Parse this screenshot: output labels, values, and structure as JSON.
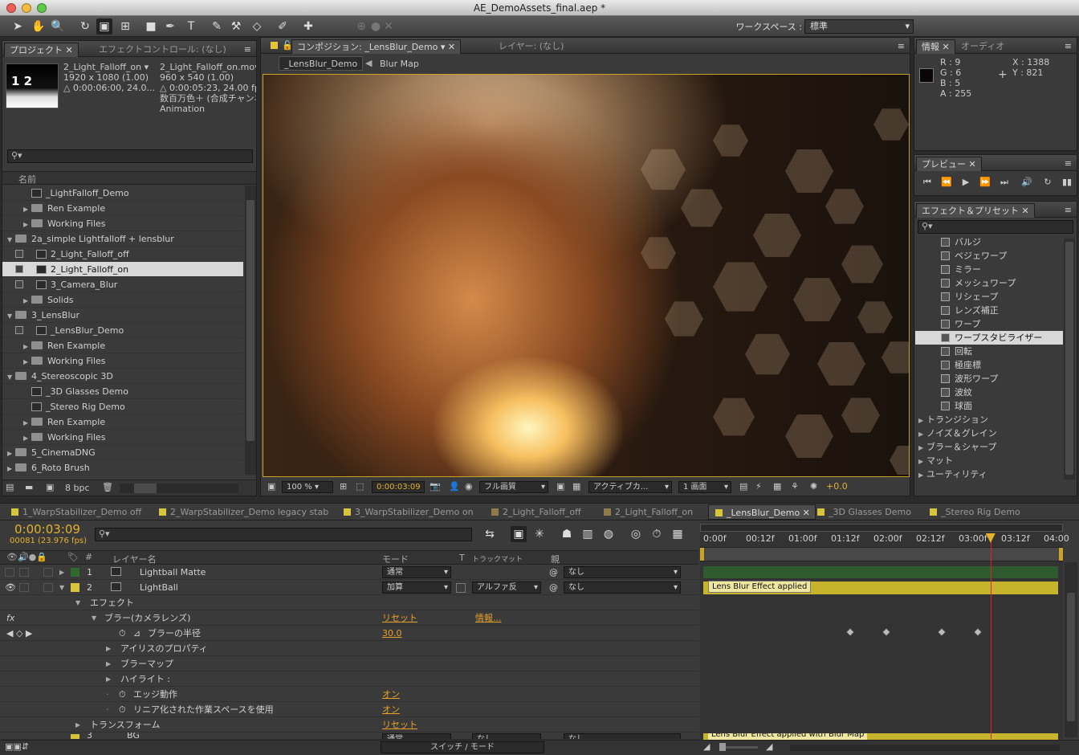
{
  "window": {
    "title": "AE_DemoAssets_final.aep *"
  },
  "workspace": {
    "label": "ワークスペース :",
    "value": "標準"
  },
  "project_panel": {
    "tabs": [
      "プロジェクト",
      "エフェクトコントロール: (なし)"
    ],
    "preview": {
      "thumb_text": "1 2",
      "name": "2_Light_Falloff_on ▾",
      "dims": "1920 x 1080 (1.00)",
      "duration": "△ 0:00:06:00, 24.0...",
      "src_name": "2_Light_Falloff_on.mov",
      "src_dims": "960 x 540 (1.00)",
      "src_duration": "△ 0:00:05:23, 24.00 fps",
      "src_color": "数百万色＋ (合成チャンネル)",
      "src_codec": "Animation"
    },
    "search_placeholder": "",
    "column_name": "名前",
    "items": [
      {
        "label": "_LightFalloff_Demo",
        "type": "comp",
        "indent": 2,
        "tri": ""
      },
      {
        "label": "Ren Example",
        "type": "folder",
        "indent": 2,
        "tri": "▶"
      },
      {
        "label": "Working Files",
        "type": "folder",
        "indent": 2,
        "tri": "▶"
      },
      {
        "label": "2a_simple Lightfalloff + lensblur",
        "type": "folder",
        "indent": 0,
        "tri": "▼"
      },
      {
        "label": "2_Light_Falloff_off",
        "type": "comp",
        "indent": 1,
        "tri": "",
        "chk": true
      },
      {
        "label": "2_Light_Falloff_on",
        "type": "comp",
        "indent": 1,
        "tri": "",
        "chk": true,
        "selected": true
      },
      {
        "label": "3_Camera_Blur",
        "type": "comp",
        "indent": 1,
        "tri": "",
        "chk": true
      },
      {
        "label": "Solids",
        "type": "folder",
        "indent": 2,
        "tri": "▶"
      },
      {
        "label": "3_LensBlur",
        "type": "folder",
        "indent": 0,
        "tri": "▼"
      },
      {
        "label": "_LensBlur_Demo",
        "type": "comp",
        "indent": 1,
        "tri": "",
        "chk": true
      },
      {
        "label": "Ren Example",
        "type": "folder",
        "indent": 2,
        "tri": "▶"
      },
      {
        "label": "Working Files",
        "type": "folder",
        "indent": 2,
        "tri": "▶"
      },
      {
        "label": "4_Stereoscopic 3D",
        "type": "folder",
        "indent": 0,
        "tri": "▼"
      },
      {
        "label": "_3D Glasses Demo",
        "type": "comp",
        "indent": 2,
        "tri": ""
      },
      {
        "label": "_Stereo Rig Demo",
        "type": "comp",
        "indent": 2,
        "tri": ""
      },
      {
        "label": "Ren Example",
        "type": "folder",
        "indent": 2,
        "tri": "▶"
      },
      {
        "label": "Working Files",
        "type": "folder",
        "indent": 2,
        "tri": "▶"
      },
      {
        "label": "5_CinemaDNG",
        "type": "folder",
        "indent": 0,
        "tri": "▶"
      },
      {
        "label": "6_Roto Brush",
        "type": "folder",
        "indent": 0,
        "tri": "▶"
      }
    ],
    "bpc": "8 bpc"
  },
  "comp_panel": {
    "tabs": [
      "コンポジション: _LensBlur_Demo",
      "レイヤー: (なし)"
    ],
    "breadcrumb": [
      "_LensBlur_Demo",
      "Blur Map"
    ],
    "zoom": "100 %",
    "timecode": "0:00:03:09",
    "resolution": "フル画質",
    "camera": "アクティブカ...",
    "views": "1 画面",
    "exposure": "+0.0"
  },
  "info_panel": {
    "tabs": [
      "情報",
      "オーディオ"
    ],
    "r": "R : 9",
    "g": "G : 6",
    "b": "B : 5",
    "a": "A : 255",
    "x": "X : 1388",
    "y": "Y : 821",
    "swatch": "#090605"
  },
  "preview_panel": {
    "tab": "プレビュー"
  },
  "effects_panel": {
    "tab": "エフェクト＆プリセット",
    "items": [
      {
        "label": "バルジ",
        "leaf": true
      },
      {
        "label": "ベジェワープ",
        "leaf": true
      },
      {
        "label": "ミラー",
        "leaf": true
      },
      {
        "label": "メッシュワープ",
        "leaf": true
      },
      {
        "label": "リシェープ",
        "leaf": true
      },
      {
        "label": "レンズ補正",
        "leaf": true
      },
      {
        "label": "ワープ",
        "leaf": true
      },
      {
        "label": "ワープスタビライザー",
        "leaf": true,
        "selected": true
      },
      {
        "label": "回転",
        "leaf": true
      },
      {
        "label": "極座標",
        "leaf": true
      },
      {
        "label": "波形ワープ",
        "leaf": true
      },
      {
        "label": "波紋",
        "leaf": true
      },
      {
        "label": "球面",
        "leaf": true
      },
      {
        "label": "トランジション",
        "leaf": false
      },
      {
        "label": "ノイズ＆グレイン",
        "leaf": false
      },
      {
        "label": "ブラー＆シャープ",
        "leaf": false
      },
      {
        "label": "マット",
        "leaf": false
      },
      {
        "label": "ユーティリティ",
        "leaf": false
      }
    ]
  },
  "timeline": {
    "tabs": [
      {
        "label": "1_WarpStabilizer_Demo off",
        "color": "#d6c43a"
      },
      {
        "label": "2_WarpStabilizer_Demo legacy stab",
        "color": "#d6c43a"
      },
      {
        "label": "3_WarpStabilizer_Demo on",
        "color": "#d6c43a"
      },
      {
        "label": "2_Light_Falloff_off",
        "color": "#8f7a4a"
      },
      {
        "label": "2_Light_Falloff_on",
        "color": "#8f7a4a"
      },
      {
        "label": "_LensBlur_Demo",
        "color": "#d6c43a",
        "active": true
      },
      {
        "label": "_3D Glasses Demo",
        "color": "#d6c43a"
      },
      {
        "label": "_Stereo Rig Demo",
        "color": "#d6c43a"
      }
    ],
    "timecode": "0:00:03:09",
    "frame": "00081 (23.976 fps)",
    "col_layer": "レイヤー名",
    "col_mode": "モード",
    "col_t": "T",
    "col_trackmatte": "トラックマット",
    "col_parent": "親",
    "ruler": [
      "0:00f",
      "00:12f",
      "01:00f",
      "01:12f",
      "02:00f",
      "02:12f",
      "03:00f",
      "03:12f",
      "04:00"
    ],
    "layers": [
      {
        "num": "1",
        "name": "Lightball Matte",
        "mode": "通常",
        "trackmatte": "",
        "parent": "なし",
        "color": "#2f6b2f"
      },
      {
        "num": "2",
        "name": "LightBall",
        "mode": "加算",
        "trackmatte": "アルファ反",
        "parent": "なし",
        "color": "#d6c43a"
      }
    ],
    "effects_label": "エフェクト",
    "effect_name": "ブラー(カメラレンズ)",
    "reset": "リセット",
    "about": "情報...",
    "blur_radius_label": "ブラーの半径",
    "blur_radius_value": "30.0",
    "props": [
      "アイリスのプロパティ",
      "ブラーマップ",
      "ハイライト :"
    ],
    "edge_label": "エッジ動作",
    "edge_value": "オン",
    "linear_label": "リニア化された作業スペースを使用",
    "linear_value": "オン",
    "transform_label": "トランスフォーム",
    "layer3_num": "3",
    "layer3_name": "BG",
    "layer3_mode": "通常",
    "layer3_matte": "なし",
    "layer3_parent": "なし",
    "bar2_label": "Lens Blur Effect applied",
    "bar3_label": "Lens Blur Effect applied with Blur Map",
    "switch_mode": "スイッチ / モード",
    "playhead_frac": 0.797
  }
}
